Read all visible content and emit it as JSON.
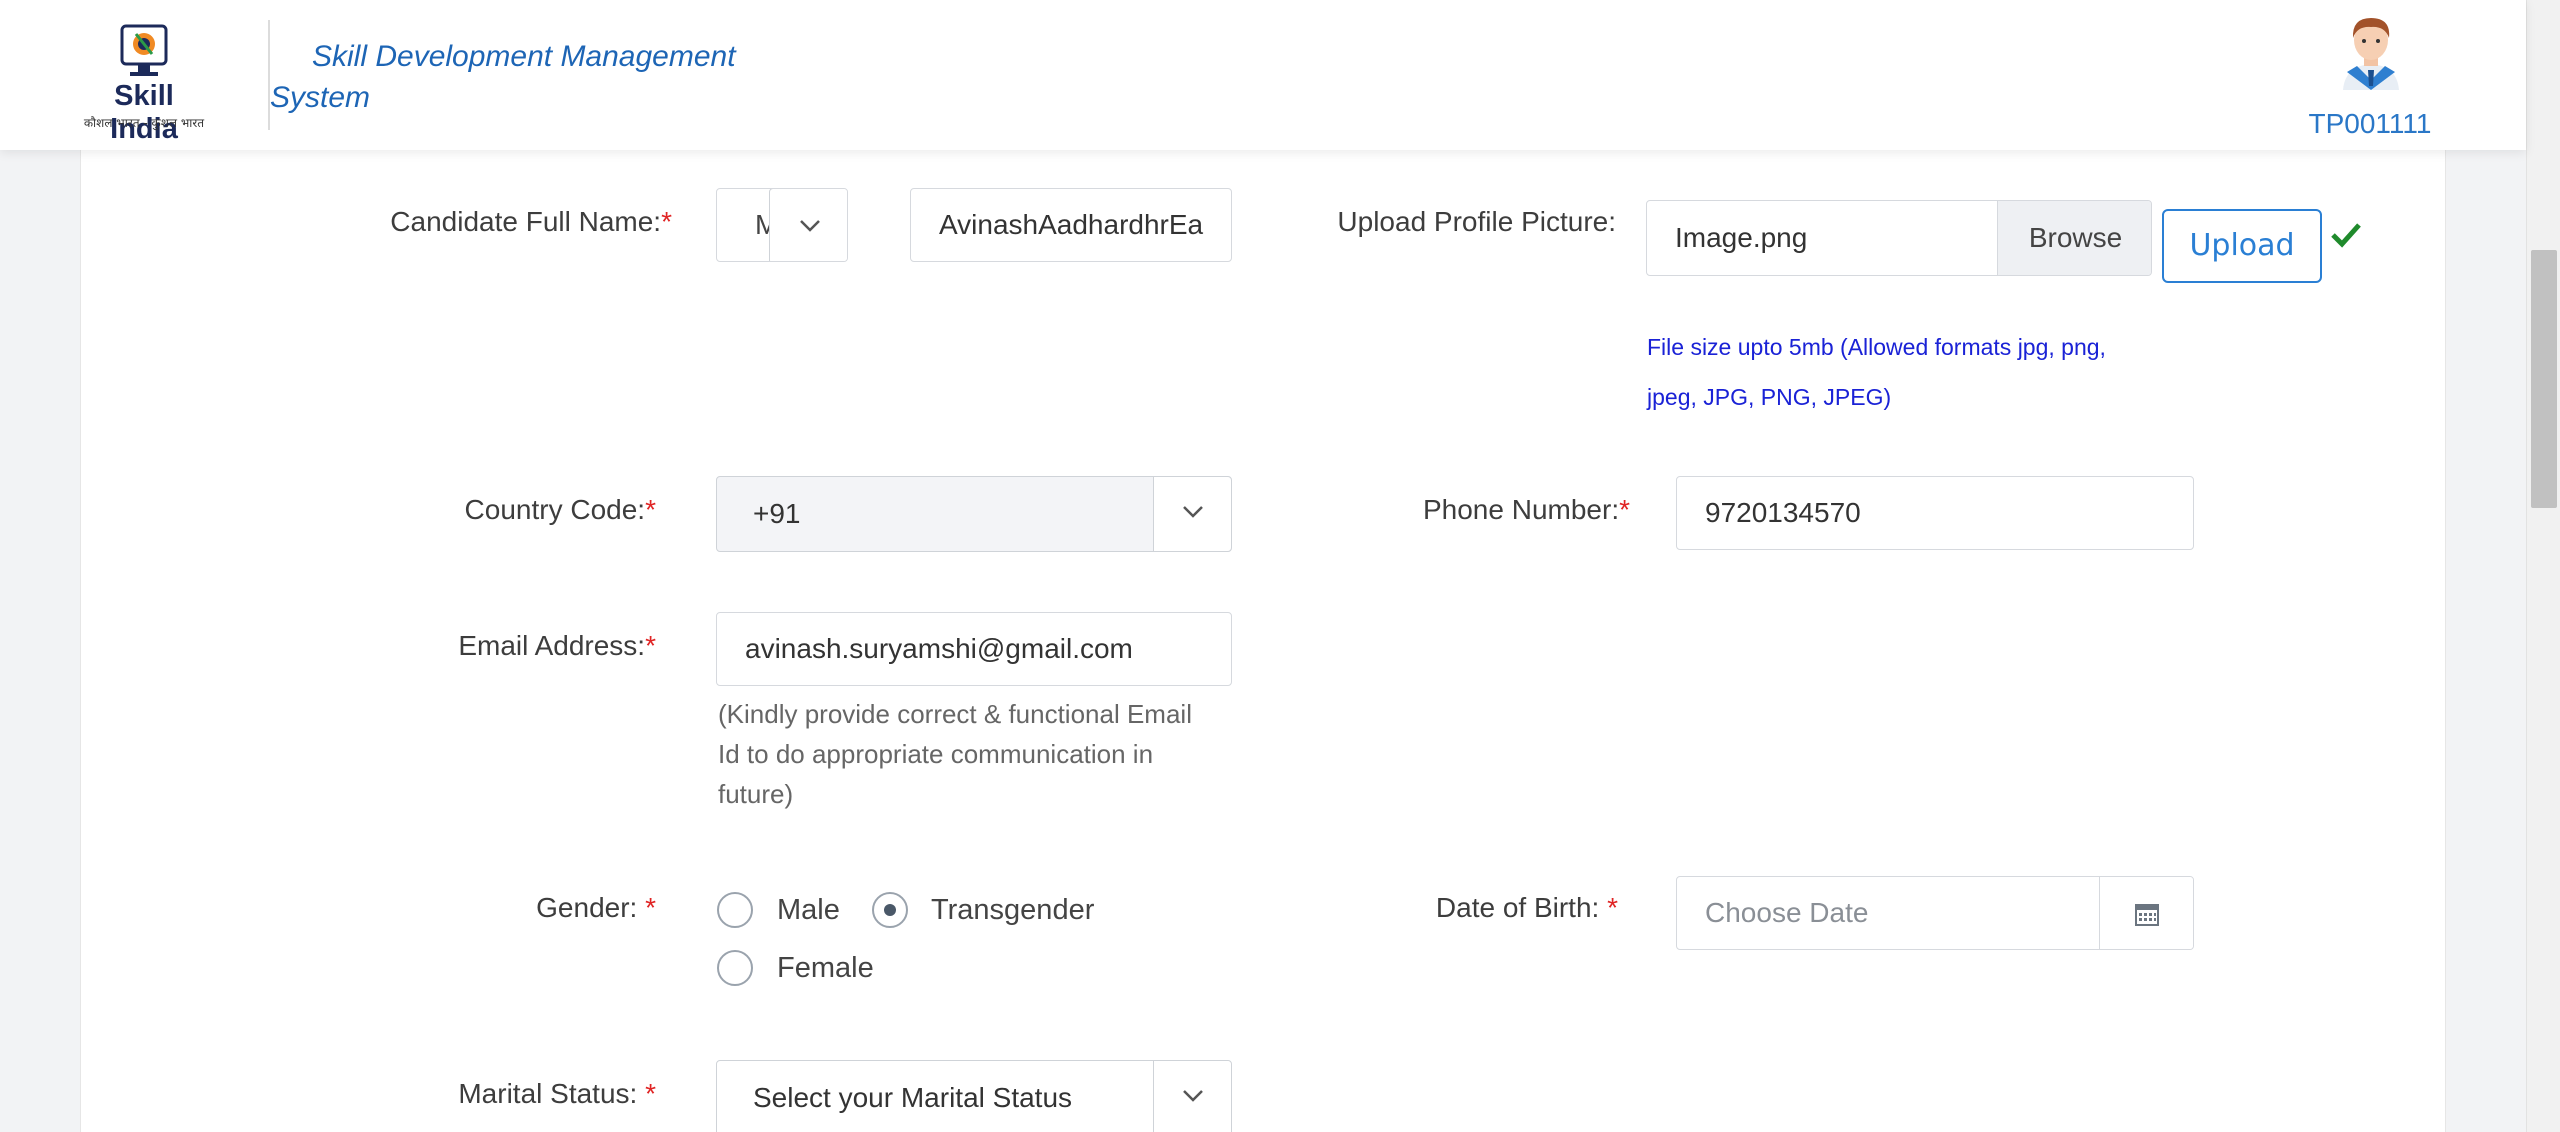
{
  "header": {
    "logo_brand": "Skill India",
    "logo_tagline": "कौशल भारत - कुशल भारत",
    "app_title": "Skill Development Management System",
    "user_id": "TP001111"
  },
  "form": {
    "full_name": {
      "label": "Candidate Full Name:",
      "required_mark": "*",
      "title_value": "M",
      "name_value": "AvinashAadhardhrEa"
    },
    "profile_picture": {
      "label": "Upload Profile Picture:",
      "file_name": "Image.png",
      "browse_label": "Browse",
      "upload_label": "Upload",
      "hint": "File size upto 5mb (Allowed formats jpg, png, jpeg, JPG, PNG, JPEG)"
    },
    "country_code": {
      "label": "Country Code:",
      "required_mark": "*",
      "value": "+91"
    },
    "phone": {
      "label": "Phone Number:",
      "required_mark": "*",
      "value": "9720134570"
    },
    "email": {
      "label": "Email Address:",
      "required_mark": "*",
      "value": "avinash.suryamshi@gmail.com",
      "hint": "(Kindly provide correct & functional Email Id to do appropriate communication in future)"
    },
    "gender": {
      "label": "Gender: ",
      "required_mark": "*",
      "options": [
        "Male",
        "Transgender",
        "Female"
      ],
      "selected": "Transgender"
    },
    "dob": {
      "label": "Date of Birth: ",
      "required_mark": "*",
      "placeholder": "Choose Date"
    },
    "marital_status": {
      "label": "Marital Status: ",
      "required_mark": "*",
      "value": "Select your Marital Status"
    }
  },
  "colors": {
    "accent_blue": "#2a7fd4",
    "title_blue": "#1d65b5",
    "required_red": "#e02424",
    "hint_blue": "#1a22d6",
    "check_green": "#1f8a2c"
  }
}
